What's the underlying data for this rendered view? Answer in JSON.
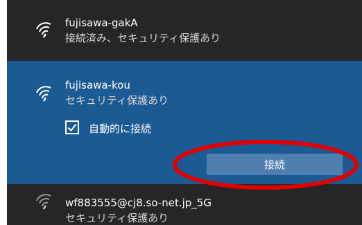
{
  "networks": [
    {
      "ssid": "fujisawa-gakA",
      "status": "接続済み、セキュリティ保護あり",
      "icon": "wifi-icon"
    },
    {
      "ssid": "fujisawa-kou",
      "status": "セキュリティ保護あり",
      "icon": "wifi-icon",
      "auto_connect_label": "自動的に接続",
      "auto_connect_checked": true,
      "connect_label": "接続"
    },
    {
      "ssid": "wf883555@cj8.so-net.jp_5G",
      "status": "セキュリティ保護あり",
      "icon": "wifi-icon"
    }
  ],
  "colors": {
    "panel_bg": "#262626",
    "selected_bg": "#1c5a94",
    "button_bg": "#4f7fae",
    "annotation": "#e00000"
  }
}
